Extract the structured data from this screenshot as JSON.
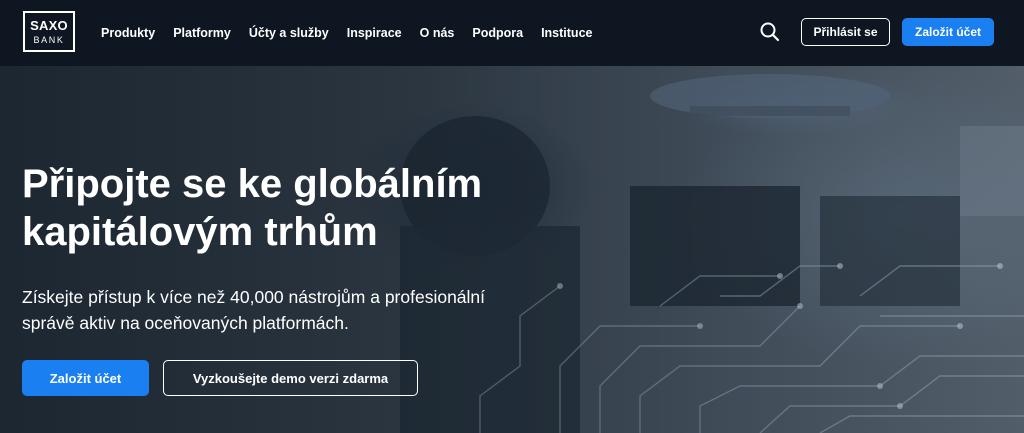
{
  "brand": {
    "logo_top": "SAXO",
    "logo_bottom": "BANK"
  },
  "nav": {
    "items": [
      {
        "label": "Produkty"
      },
      {
        "label": "Platformy"
      },
      {
        "label": "Účty a služby"
      },
      {
        "label": "Inspirace"
      },
      {
        "label": "O nás"
      },
      {
        "label": "Podpora"
      },
      {
        "label": "Instituce"
      }
    ]
  },
  "header": {
    "search_icon": "search-icon",
    "login_label": "Přihlásit se",
    "signup_label": "Založit účet"
  },
  "hero": {
    "title_line1": "Připojte se ke globálním",
    "title_line2": "kapitálovým trhům",
    "subtitle_line1": "Získejte přístup k více než 40,000 nástrojům a profesionální",
    "subtitle_line2": "správě aktiv na oceňovaných platformách.",
    "primary_label": "Založit účet",
    "secondary_label": "Vyzkoušejte demo verzi zdarma"
  },
  "colors": {
    "header_bg": "#0d1621",
    "accent": "#1a7ff0",
    "text": "#ffffff"
  }
}
